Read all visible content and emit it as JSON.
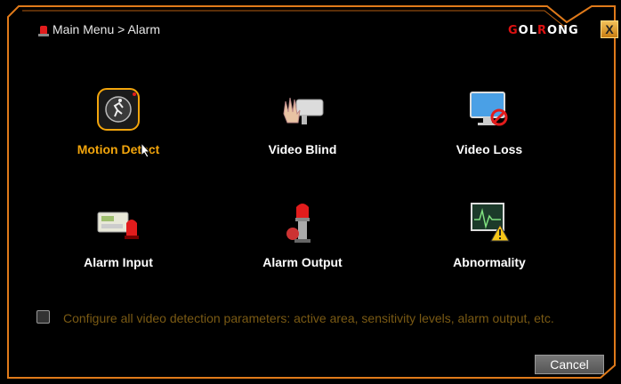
{
  "title": "Main Menu > Alarm",
  "logo": {
    "part1": "G",
    "part2": "OL",
    "part3": "R",
    "part4": "ONG"
  },
  "close_label": "X",
  "tiles": [
    {
      "label": "Motion Detect",
      "icon": "motion-detect-icon",
      "selected": true
    },
    {
      "label": "Video Blind",
      "icon": "video-blind-icon"
    },
    {
      "label": "Video Loss",
      "icon": "video-loss-icon"
    },
    {
      "label": "Alarm Input",
      "icon": "alarm-input-icon"
    },
    {
      "label": "Alarm Output",
      "icon": "alarm-output-icon"
    },
    {
      "label": "Abnormality",
      "icon": "abnormality-icon"
    }
  ],
  "hint": "Configure all video detection parameters: active area, sensitivity levels, alarm output, etc.",
  "cancel_label": "Cancel",
  "colors": {
    "accent": "#f2a50c",
    "frame": "#e07a1a",
    "hint": "#7a5a14"
  }
}
